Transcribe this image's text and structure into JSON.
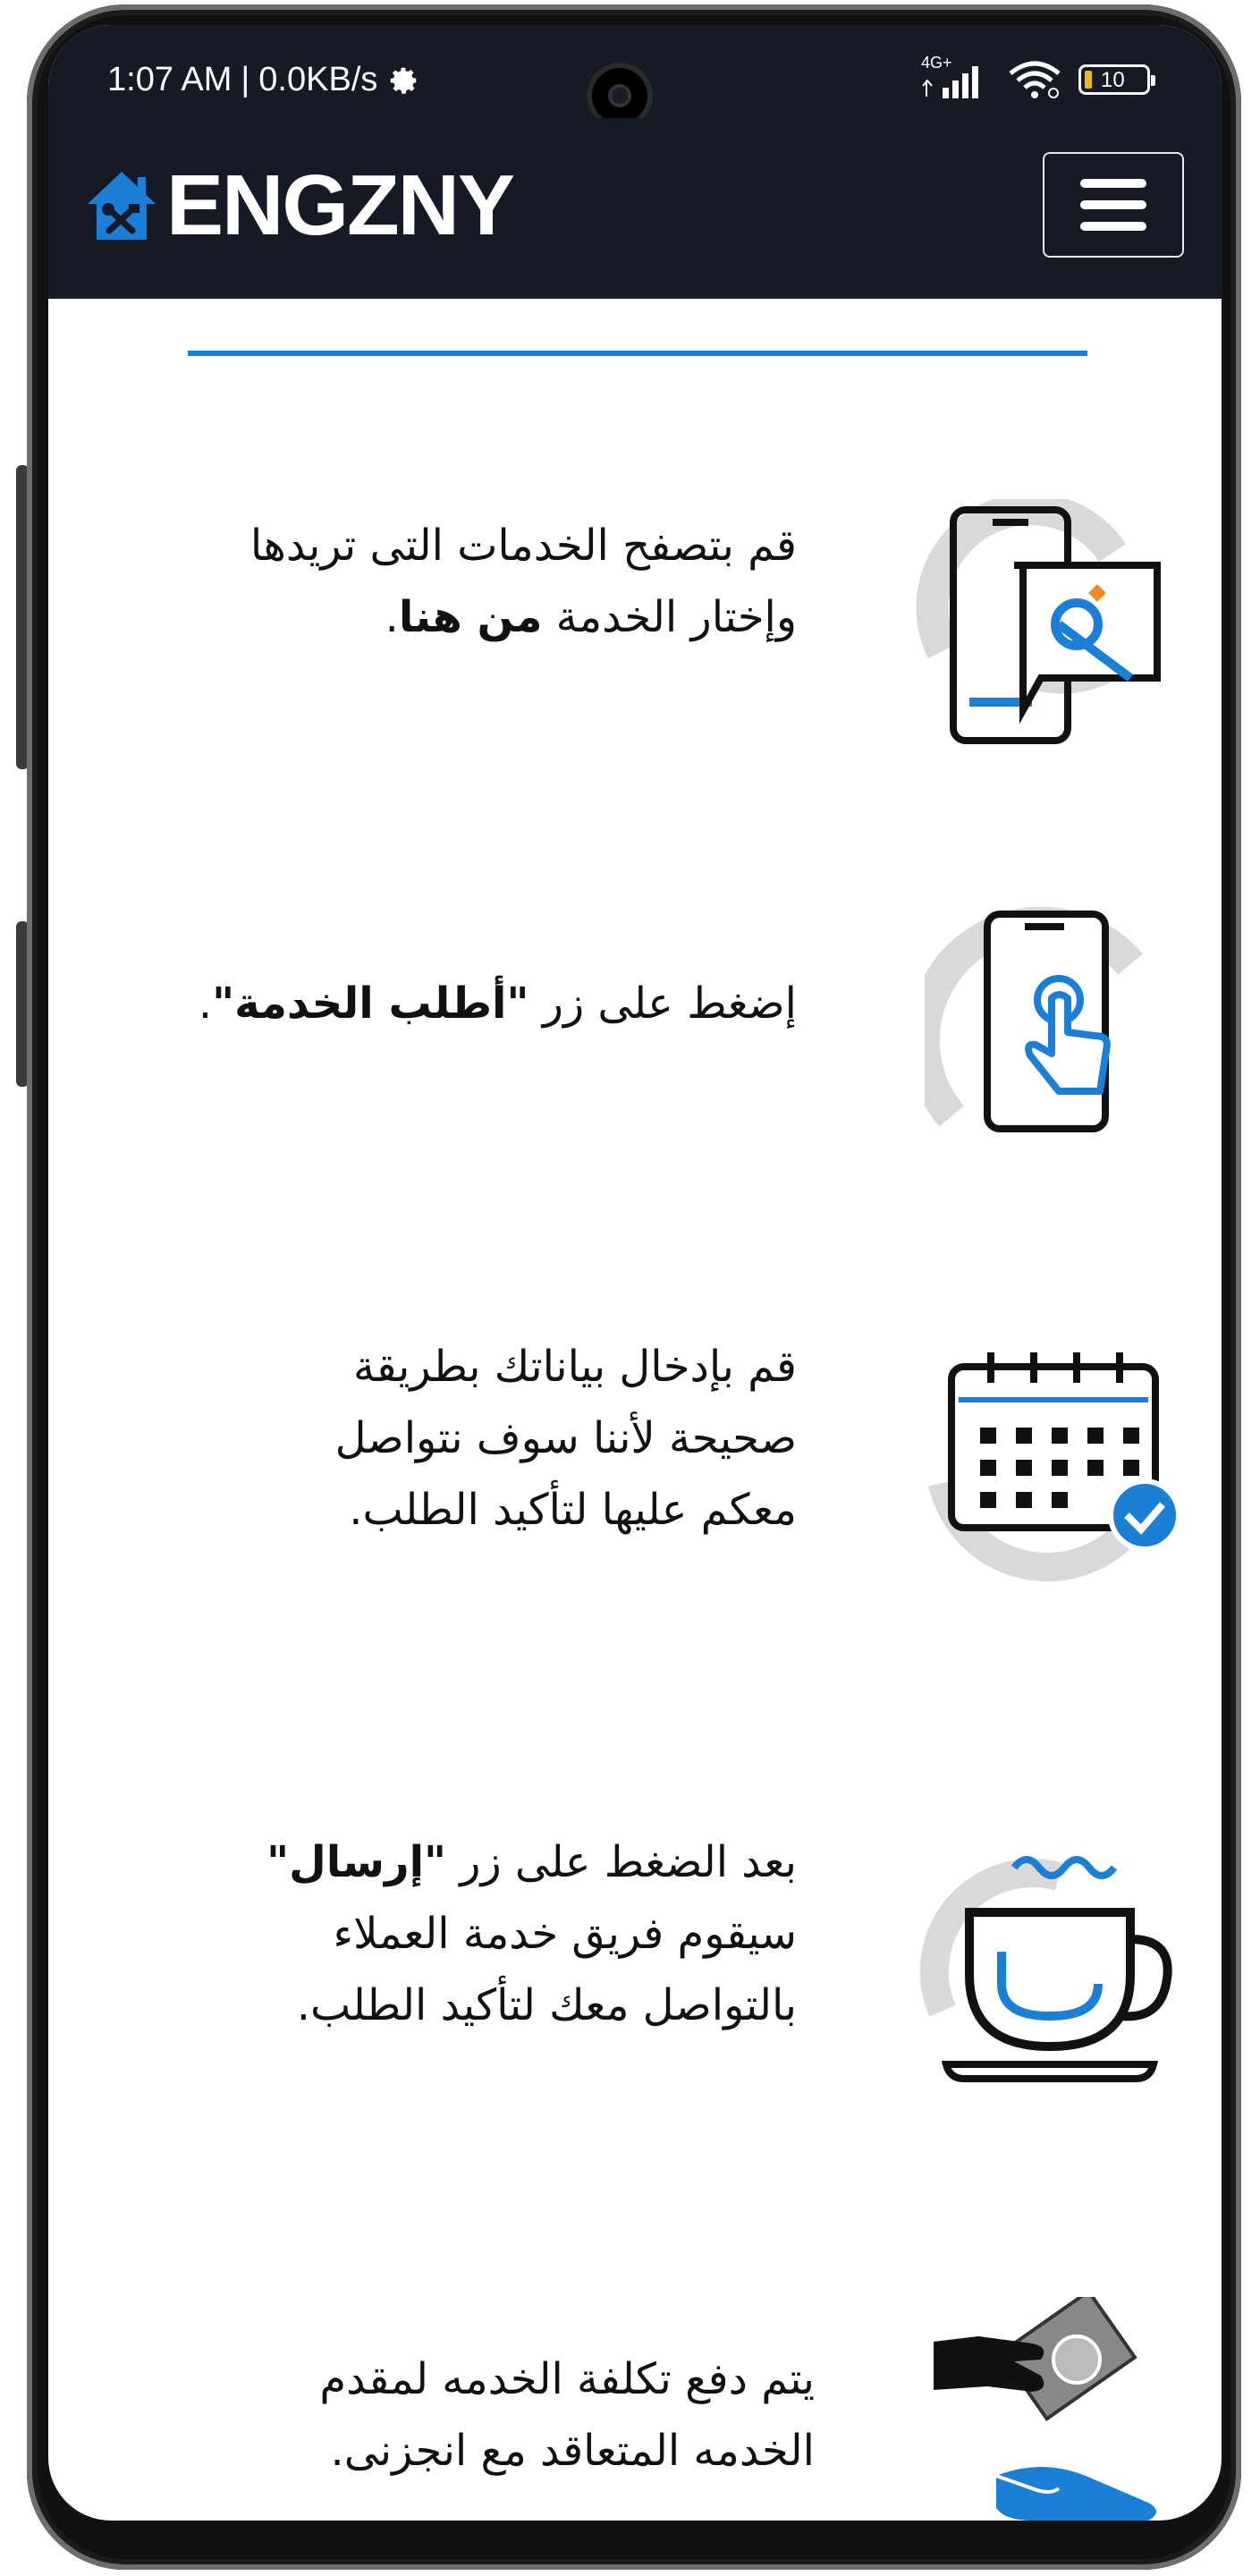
{
  "status_bar": {
    "time": "1:07 AM",
    "separator": "|",
    "speed": "0.0KB/s",
    "network": "4G+",
    "battery": "10"
  },
  "navbar": {
    "brand": "ENGZNY",
    "menu_icon": "hamburger-icon",
    "brand_icon": "house-tools-icon"
  },
  "colors": {
    "accent": "#1b7fd6",
    "navbar_bg": "#161a26",
    "text": "#111111"
  },
  "steps": [
    {
      "line1": "قم بتصفح الخدمات التى تريدها",
      "line2_pre": "وإختار الخدمة ",
      "line2_bold": "من هنا",
      "line2_post": ".",
      "icon": "phone-service-icon"
    },
    {
      "pre": "إضغط على زر ",
      "bold": "\"أطلب الخدمة\"",
      "post": ".",
      "icon": "tap-phone-icon"
    },
    {
      "line1": "قم بإدخال بياناتك بطريقة",
      "line2": "صحيحة لأننا سوف نتواصل",
      "line3": "معكم عليها لتأكيد الطلب.",
      "icon": "calendar-check-icon"
    },
    {
      "line1_pre": "بعد الضغط على زر ",
      "line1_bold": "\"إرسال\"",
      "line2": "سيقوم فريق خدمة العملاء",
      "line3": "بالتواصل معك لتأكيد الطلب.",
      "icon": "coffee-cup-icon"
    },
    {
      "line1": "يتم دفع تكلفة الخدمه لمقدم",
      "line2": "الخدمه المتعاقد مع انجزنى.",
      "icon": "payment-hands-icon"
    }
  ]
}
